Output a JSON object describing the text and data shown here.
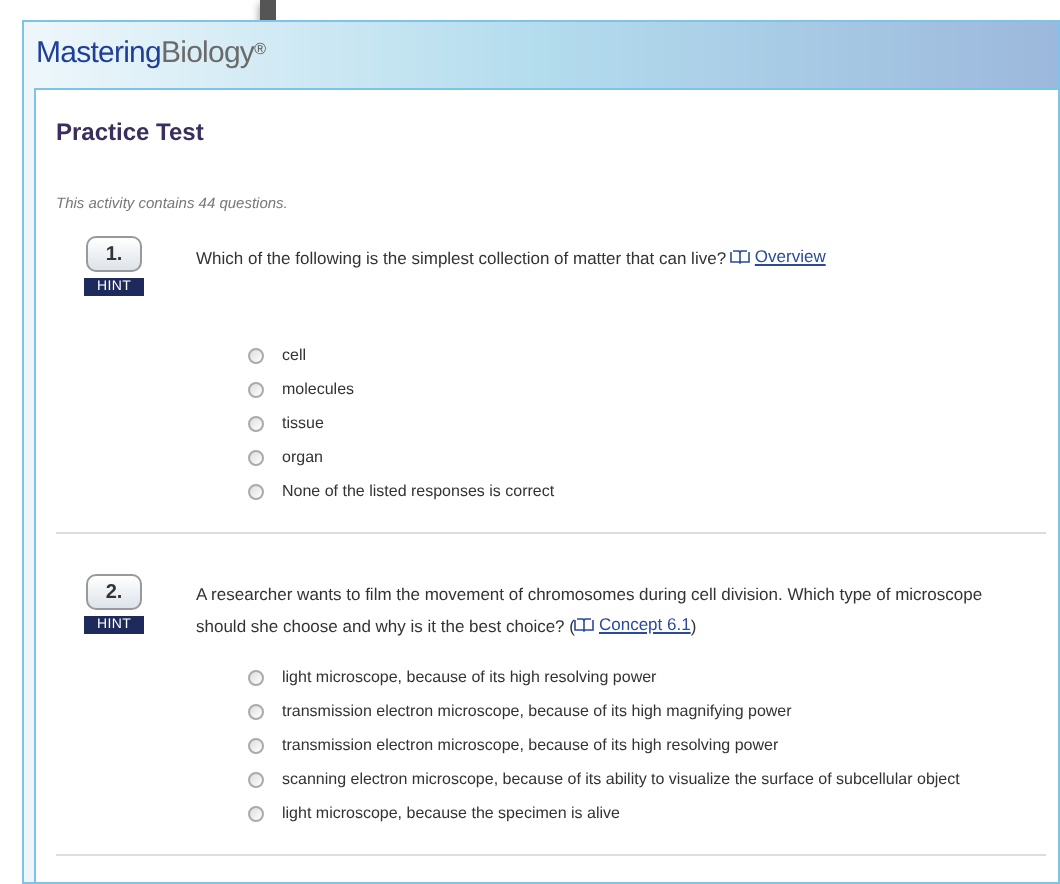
{
  "logo": {
    "first": "Mastering",
    "second": "Biology",
    "mark": "®"
  },
  "title": "Practice Test",
  "subtitle": "This activity contains 44 questions.",
  "questions": [
    {
      "number": "1.",
      "hint": "HINT",
      "text": "Which of the following is the simplest collection of matter that can live?",
      "link": "Overview",
      "options": [
        {
          "label": "cell",
          "selected": false
        },
        {
          "label": "molecules",
          "selected": false
        },
        {
          "label": "tissue",
          "selected": false
        },
        {
          "label": "organ",
          "selected": false
        },
        {
          "label": "None of the listed responses is correct",
          "selected": false
        }
      ]
    },
    {
      "number": "2.",
      "hint": "HINT",
      "text": "A researcher wants to film the movement of chromosomes during cell division. Which type of microscope should she choose and why is it the best choice?",
      "before_link": "(",
      "link": "Concept 6.1",
      "after_link": ")",
      "options": [
        {
          "label": "light microscope, because of its high resolving power",
          "selected": false
        },
        {
          "label": "transmission electron microscope, because of its high magnifying power",
          "selected": false
        },
        {
          "label": "transmission electron microscope, because of its high resolving power",
          "selected": false
        },
        {
          "label": "scanning electron microscope, because of its ability to visualize the surface of subcellular object",
          "selected": false
        },
        {
          "label": "light microscope, because the specimen is alive",
          "selected": false
        }
      ]
    }
  ]
}
